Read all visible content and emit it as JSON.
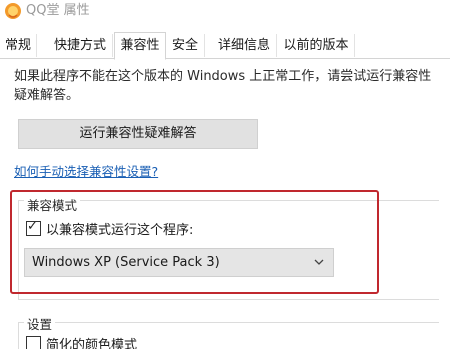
{
  "window": {
    "title": "QQ堂 属性",
    "icon": "qq-app-icon"
  },
  "tabs": [
    {
      "label": "常规",
      "selected": false
    },
    {
      "label": "快捷方式",
      "selected": false
    },
    {
      "label": "兼容性",
      "selected": true
    },
    {
      "label": "安全",
      "selected": false
    },
    {
      "label": "详细信息",
      "selected": false
    },
    {
      "label": "以前的版本",
      "selected": false
    }
  ],
  "compat": {
    "description": "如果此程序不能在这个版本的 Windows 上正常工作，请尝试运行兼容性疑难解答。",
    "run_troubleshooter_label": "运行兼容性疑难解答",
    "manual_link": "如何手动选择兼容性设置?",
    "group_title": "兼容模式",
    "run_in_compat_label": "以兼容模式运行这个程序:",
    "run_in_compat_checked": true,
    "os_selected": "Windows XP (Service Pack 3)"
  },
  "settings": {
    "group_title": "设置",
    "reduced_color_label": "简化的颜色模式",
    "reduced_color_checked": false
  },
  "colors": {
    "highlight": "#c0282e",
    "link": "#1a5fb4"
  }
}
